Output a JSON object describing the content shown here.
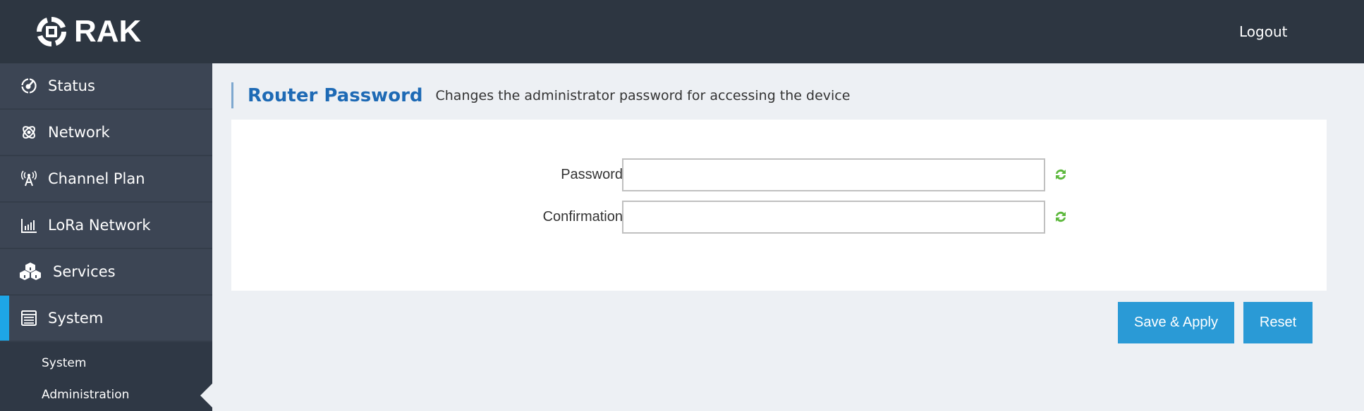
{
  "header": {
    "brand": "RAK",
    "logout_label": "Logout"
  },
  "sidebar": {
    "items": [
      {
        "label": "Status",
        "icon": "dashboard-icon"
      },
      {
        "label": "Network",
        "icon": "network-icon"
      },
      {
        "label": "Channel Plan",
        "icon": "antenna-icon"
      },
      {
        "label": "LoRa Network",
        "icon": "bar-chart-icon"
      },
      {
        "label": "Services",
        "icon": "cubes-icon"
      },
      {
        "label": "System",
        "icon": "list-icon",
        "active": true
      }
    ],
    "submenu": [
      {
        "label": "System"
      },
      {
        "label": "Administration",
        "active": true
      }
    ]
  },
  "page": {
    "title": "Router Password",
    "description": "Changes the administrator password for accessing the device"
  },
  "form": {
    "password": {
      "label": "Password",
      "value": "",
      "placeholder": ""
    },
    "confirmation": {
      "label": "Confirmation",
      "value": "",
      "placeholder": ""
    }
  },
  "actions": {
    "save_label": "Save & Apply",
    "reset_label": "Reset"
  },
  "colors": {
    "header_bg": "#2d3641",
    "sidebar_bg": "#3c4554",
    "accent": "#1ea6e6",
    "button": "#2a9ad6",
    "title": "#1e6ab5",
    "refresh_icon": "#5cb83c"
  }
}
